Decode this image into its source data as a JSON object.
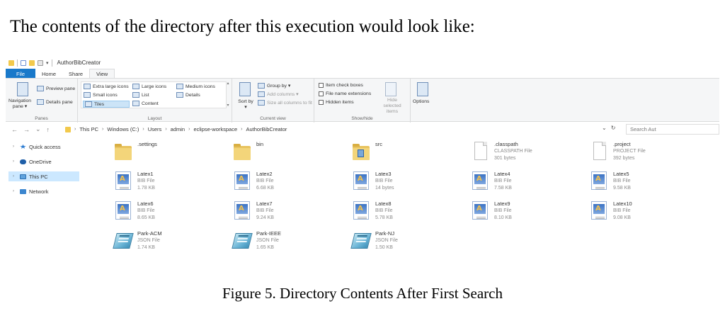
{
  "document": {
    "heading": "The contents of the directory after this execution would look like:",
    "caption": "Figure 5. Directory Contents After First Search"
  },
  "window": {
    "title": "AuthorBibCreator",
    "qat_arrow": "▾"
  },
  "tabs": {
    "file": "File",
    "home": "Home",
    "share": "Share",
    "view": "View"
  },
  "ribbon": {
    "panes": {
      "label": "Panes",
      "navigation_pane": "Navigation pane ▾",
      "preview_pane": "Preview pane",
      "details_pane": "Details pane"
    },
    "layout": {
      "label": "Layout",
      "extra_large_icons": "Extra large icons",
      "large_icons": "Large icons",
      "medium_icons": "Medium icons",
      "small_icons": "Small icons",
      "list": "List",
      "details": "Details",
      "tiles": "Tiles",
      "content": "Content",
      "selected": "Tiles"
    },
    "current_view": {
      "label": "Current view",
      "sort_by": "Sort by ▾",
      "group_by": "Group by ▾",
      "add_columns": "Add columns ▾",
      "size_all_columns": "Size all columns to fit"
    },
    "show_hide": {
      "label": "Show/hide",
      "item_check_boxes": "Item check boxes",
      "file_name_extensions": "File name extensions",
      "hidden_items": "Hidden items",
      "hide_selected": "Hide selected items"
    },
    "options": "Options"
  },
  "address": {
    "back": "←",
    "forward": "→",
    "recent": "⌄",
    "up": "↑",
    "path": [
      "This PC",
      "Windows (C:)",
      "Users",
      "admin",
      "eclipse-workspace",
      "AuthorBibCreator"
    ],
    "search_placeholder": "Search Aut"
  },
  "nav_pane": {
    "items": [
      {
        "label": "Quick access"
      },
      {
        "label": "OneDrive"
      },
      {
        "label": "This PC"
      },
      {
        "label": "Network"
      }
    ],
    "selected": "This PC"
  },
  "files": [
    {
      "name": ".settings",
      "type": "",
      "size": "",
      "icon": "folder-icon"
    },
    {
      "name": "bin",
      "type": "",
      "size": "",
      "icon": "folder-icon"
    },
    {
      "name": "src",
      "type": "",
      "size": "",
      "icon": "source-folder-icon"
    },
    {
      "name": ".classpath",
      "type": "CLASSPATH File",
      "size": "301 bytes",
      "icon": "blank-file-icon"
    },
    {
      "name": ".project",
      "type": "PROJECT File",
      "size": "392 bytes",
      "icon": "blank-file-icon"
    },
    {
      "name": "Latex1",
      "type": "BIB File",
      "size": "1.78 KB",
      "icon": "bib-file-icon"
    },
    {
      "name": "Latex2",
      "type": "BIB File",
      "size": "6.68 KB",
      "icon": "bib-file-icon"
    },
    {
      "name": "Latex3",
      "type": "BIB File",
      "size": "14 bytes",
      "icon": "bib-file-icon"
    },
    {
      "name": "Latex4",
      "type": "BIB File",
      "size": "7.58 KB",
      "icon": "bib-file-icon"
    },
    {
      "name": "Latex5",
      "type": "BIB File",
      "size": "9.58 KB",
      "icon": "bib-file-icon"
    },
    {
      "name": "Latex6",
      "type": "BIB File",
      "size": "8.65 KB",
      "icon": "bib-file-icon"
    },
    {
      "name": "Latex7",
      "type": "BIB File",
      "size": "9.24 KB",
      "icon": "bib-file-icon"
    },
    {
      "name": "Latex8",
      "type": "BIB File",
      "size": "5.78 KB",
      "icon": "bib-file-icon"
    },
    {
      "name": "Latex9",
      "type": "BIB File",
      "size": "8.10 KB",
      "icon": "bib-file-icon"
    },
    {
      "name": "Latex10",
      "type": "BIB File",
      "size": "9.08 KB",
      "icon": "bib-file-icon"
    },
    {
      "name": "Park-ACM",
      "type": "JSON File",
      "size": "1.74 KB",
      "icon": "json-file-icon"
    },
    {
      "name": "Park-IEEE",
      "type": "JSON File",
      "size": "1.65 KB",
      "icon": "json-file-icon"
    },
    {
      "name": "Park-NJ",
      "type": "JSON File",
      "size": "1.50 KB",
      "icon": "json-file-icon"
    }
  ],
  "colors": {
    "file_tab": "#1979ca",
    "selection": "#cce8ff",
    "folder": "#f3d57a"
  }
}
